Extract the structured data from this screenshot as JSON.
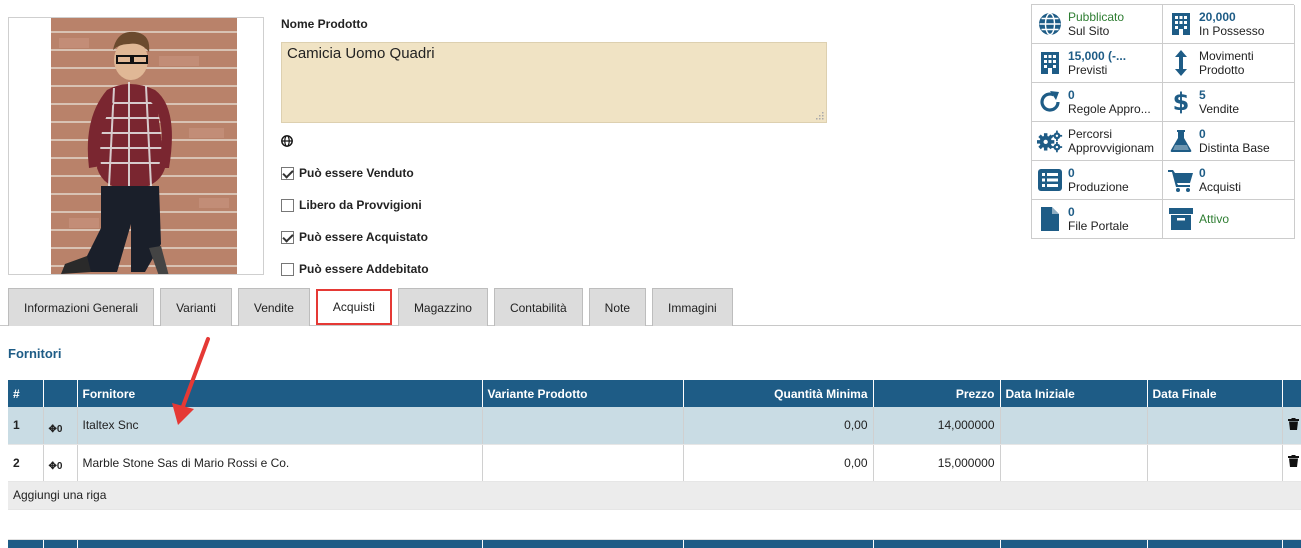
{
  "product": {
    "name_label": "Nome Prodotto",
    "name_value": "Camicia Uomo Quadri"
  },
  "checkboxes": [
    {
      "label": "Può essere Venduto",
      "checked": true
    },
    {
      "label": "Libero da Provvigioni",
      "checked": false
    },
    {
      "label": "Può essere Acquistato",
      "checked": true
    },
    {
      "label": "Può essere Addebitato",
      "checked": false
    }
  ],
  "stats": {
    "published": {
      "line1": "Pubblicato",
      "line2": "Sul Sito",
      "icon": "globe-icon"
    },
    "on_hand": {
      "value": "20,000",
      "label": "In Possesso",
      "icon": "building-icon"
    },
    "forecast": {
      "value": "15,000 (-...",
      "label": "Previsti",
      "icon": "building-icon"
    },
    "moves": {
      "line1": "Movimenti",
      "line2": "Prodotto",
      "icon": "up-down-arrow-icon"
    },
    "reorder": {
      "value": "0",
      "label": "Regole Appro...",
      "icon": "refresh-icon"
    },
    "sales": {
      "value": "5",
      "label": "Vendite",
      "icon": "dollar-icon"
    },
    "routes": {
      "line1": "Percorsi",
      "line2": "Approvvigionam",
      "icon": "gears-icon"
    },
    "bom": {
      "value": "0",
      "label": "Distinta Base",
      "icon": "flask-icon"
    },
    "production": {
      "value": "0",
      "label": "Produzione",
      "icon": "list-icon"
    },
    "purchases": {
      "value": "0",
      "label": "Acquisti",
      "icon": "cart-icon"
    },
    "portal_files": {
      "value": "0",
      "label": "File Portale",
      "icon": "file-icon"
    },
    "active": {
      "label": "Attivo",
      "icon": "archive-icon"
    }
  },
  "tabs": [
    "Informazioni Generali",
    "Varianti",
    "Vendite",
    "Acquisti",
    "Magazzino",
    "Contabilità",
    "Note",
    "Immagini"
  ],
  "active_tab": "Acquisti",
  "section_title": "Fornitori",
  "table": {
    "headers": [
      "#",
      "",
      "Fornitore",
      "Variante Prodotto",
      "Quantità Minima",
      "Prezzo",
      "Data Iniziale",
      "Data Finale"
    ],
    "rows": [
      {
        "num": "1",
        "handle": "0",
        "supplier": "Italtex Snc",
        "variant": "",
        "min_qty": "0,00",
        "price": "14,000000",
        "start": "",
        "end": ""
      },
      {
        "num": "2",
        "handle": "0",
        "supplier": "Marble Stone Sas di Mario Rossi e Co.",
        "variant": "",
        "min_qty": "0,00",
        "price": "15,000000",
        "start": "",
        "end": ""
      }
    ],
    "add_row_label": "Aggiungi una riga"
  },
  "colors": {
    "accent": "#1e5c86",
    "highlight": "#e53935",
    "name_field_bg": "#f0e3c4",
    "selected_row": "#c9dce4",
    "green": "#2e7d32"
  }
}
